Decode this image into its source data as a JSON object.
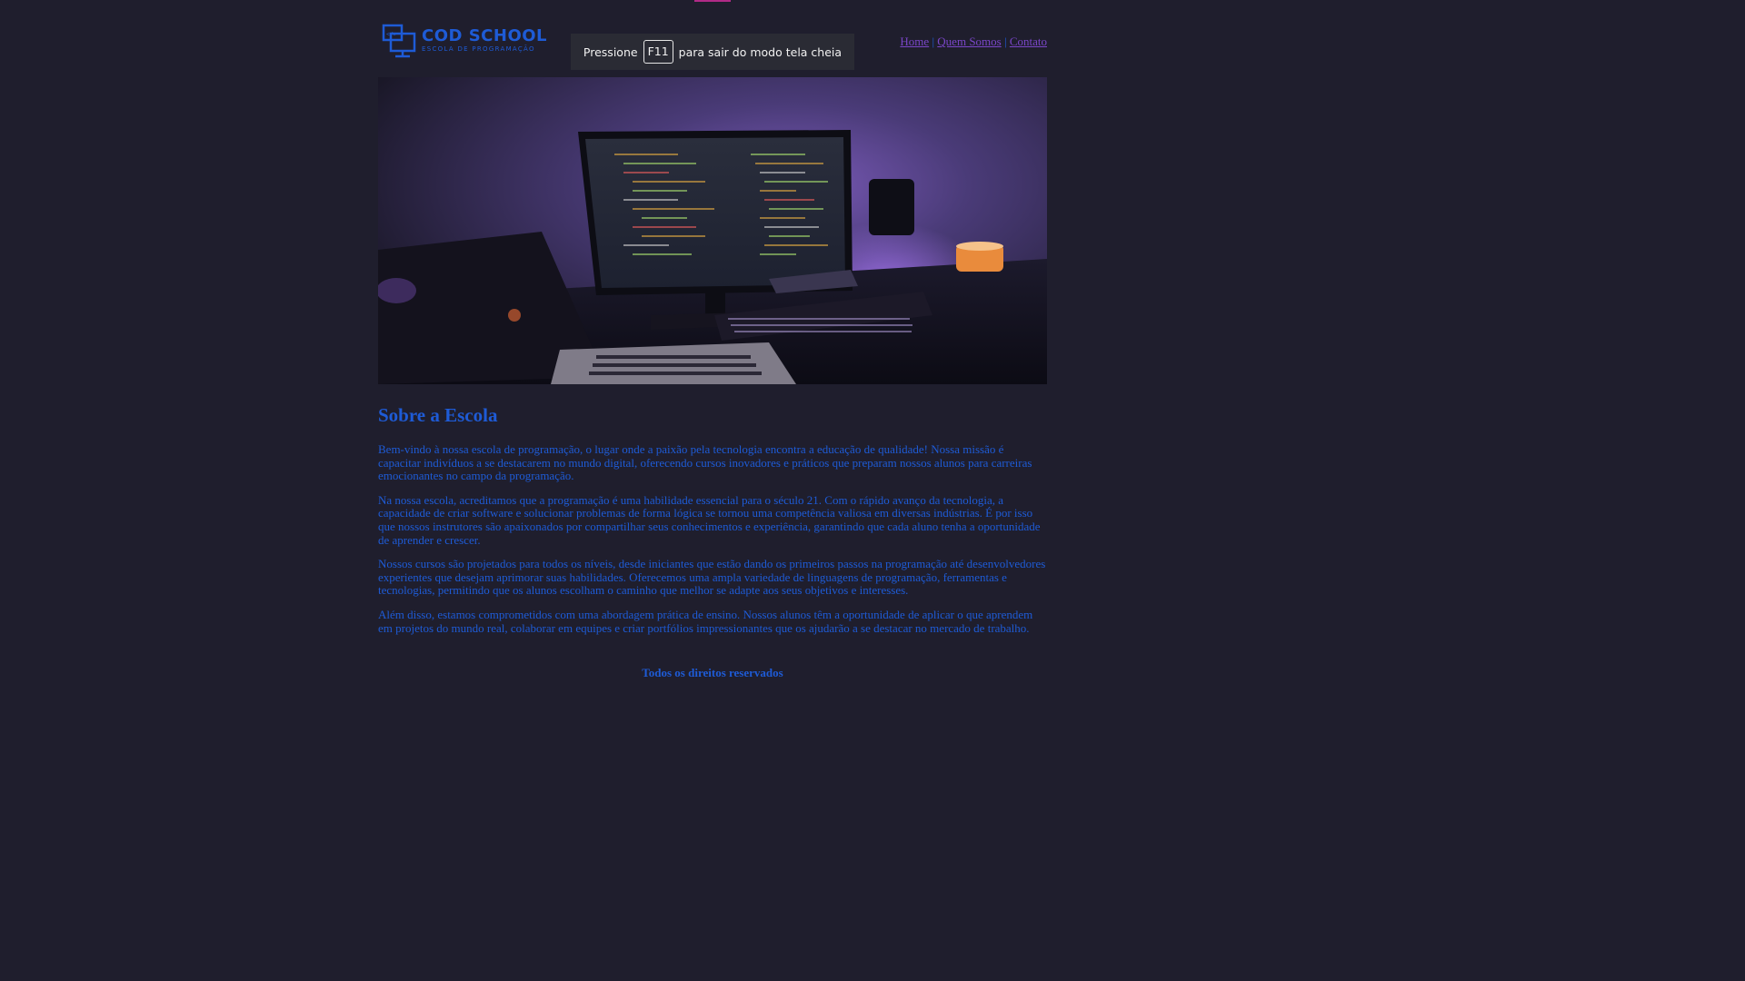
{
  "logo": {
    "name": "COD SCHOOL",
    "tagline": "ESCOLA DE PROGRAMAÇÃO"
  },
  "nav": {
    "items": [
      {
        "label": "Home"
      },
      {
        "label": "Quem Somos"
      },
      {
        "label": "Contato"
      }
    ],
    "separator": "|"
  },
  "fullscreen_notice": {
    "prefix": "Pressione",
    "key": "F11",
    "suffix": "para sair do modo tela cheia"
  },
  "hero": {
    "icon": "desk-setup-photo"
  },
  "main": {
    "title": "Sobre a Escola",
    "paragraphs": [
      "Bem-vindo à nossa escola de programação, o lugar onde a paixão pela tecnologia encontra a educação de qualidade! Nossa missão é capacitar indivíduos a se destacarem no mundo digital, oferecendo cursos inovadores e práticos que preparam nossos alunos para carreiras emocionantes no campo da programação.",
      "Na nossa escola, acreditamos que a programação é uma habilidade essencial para o século 21. Com o rápido avanço da tecnologia, a capacidade de criar software e solucionar problemas de forma lógica se tornou uma competência valiosa em diversas indústrias. É por isso que nossos instrutores são apaixonados por compartilhar seus conhecimentos e experiência, garantindo que cada aluno tenha a oportunidade de aprender e crescer.",
      "Nossos cursos são projetados para todos os níveis, desde iniciantes que estão dando os primeiros passos na programação até desenvolvedores experientes que desejam aprimorar suas habilidades. Oferecemos uma ampla variedade de linguagens de programação, ferramentas e tecnologias, permitindo que os alunos escolham o caminho que melhor se adapte aos seus objetivos e interesses.",
      "Além disso, estamos comprometidos com uma abordagem prática de ensino. Nossos alunos têm a oportunidade de aplicar o que aprendem em projetos do mundo real, colaborar em equipes e criar portfólios impressionantes que os ajudarão a se destacar no mercado de trabalho."
    ]
  },
  "footer": {
    "text": "Todos os direitos reservados"
  },
  "colors": {
    "background": "#1f1e2d",
    "text": "#1e5bd6",
    "link": "#7a46c8"
  }
}
